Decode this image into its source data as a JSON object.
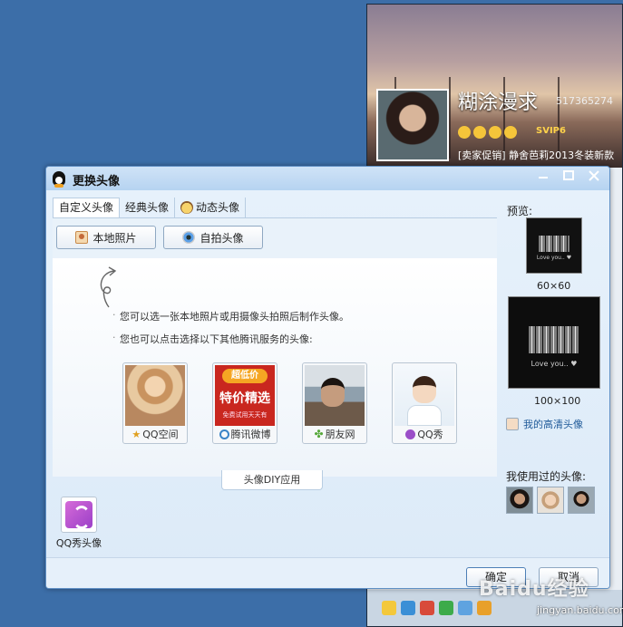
{
  "background_window": {
    "nickname": "糊涂漫求",
    "qq_number": "517365274",
    "vip_badge": "SVIP6",
    "ad_text": "[卖家促销] 静舍芭莉2013冬装新款"
  },
  "dialog": {
    "title": "更换头像",
    "tabs": [
      {
        "label": "自定义头像"
      },
      {
        "label": "经典头像"
      },
      {
        "label": "动态头像"
      }
    ],
    "toolbar": {
      "local_photo_label": "本地照片",
      "selfie_label": "自拍头像"
    },
    "hints": [
      "您可以选一张本地照片或用摄像头拍照后制作头像。",
      "您也可以点击选择以下其他腾讯服务的头像:"
    ],
    "services": [
      {
        "label": "QQ空间",
        "icon": "star-icon"
      },
      {
        "label": "腾讯微博",
        "icon": "weibo-icon",
        "promo_tag": "超低价",
        "promo_title": "特价精选",
        "promo_sub": "免费试用天天有"
      },
      {
        "label": "朋友网",
        "icon": "pengyou-icon"
      },
      {
        "label": "QQ秀",
        "icon": "qqshow-icon"
      }
    ],
    "diy_tab_label": "头像DIY应用",
    "diy_apps": [
      {
        "label": "QQ秀头像"
      }
    ],
    "preview": {
      "title": "预览:",
      "small_size": "60×60",
      "large_size": "100×100",
      "preview_caption": "Love you.. ♥",
      "hd_link": "我的高清头像"
    },
    "used_title": "我使用过的头像:",
    "buttons": {
      "ok": "确定",
      "cancel": "取消"
    }
  },
  "watermark": {
    "logo": "Baidu经验",
    "url": "jingyan.baidu.com"
  }
}
